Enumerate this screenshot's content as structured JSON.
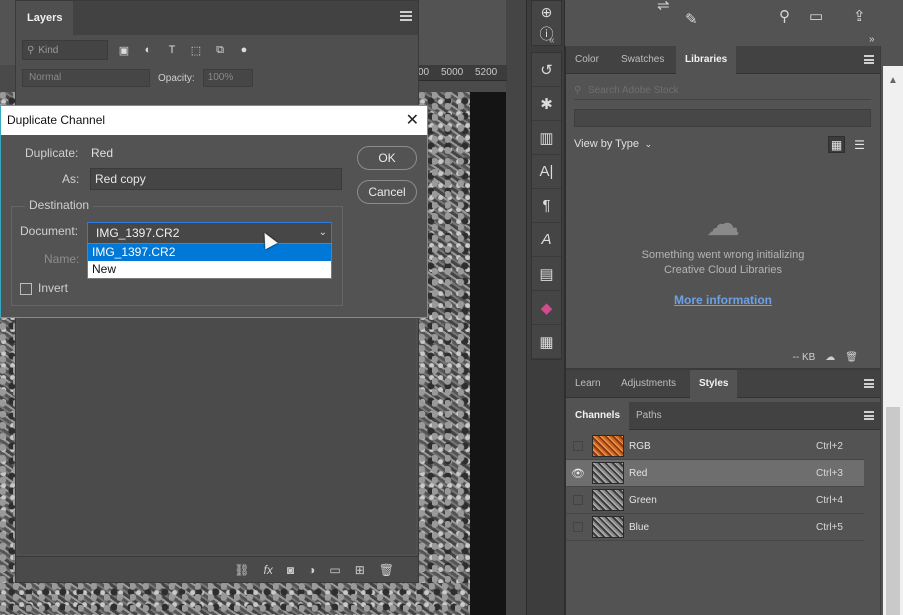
{
  "layers_panel": {
    "tab": "Layers",
    "kind_placeholder": "Kind",
    "blend_mode": "Normal",
    "opacity_label": "Opacity:",
    "opacity_value": "100%"
  },
  "ruler": {
    "ticks": [
      "00",
      "5000",
      "5200"
    ]
  },
  "dialog": {
    "title": "Duplicate Channel",
    "close": "✕",
    "duplicate_label": "Duplicate:",
    "duplicate_value": "Red",
    "as_label": "As:",
    "as_value": "Red copy",
    "ok_label": "OK",
    "cancel_label": "Cancel",
    "destination_legend": "Destination",
    "document_label": "Document:",
    "document_value": "IMG_1397.CR2",
    "document_options": [
      "IMG_1397.CR2",
      "New"
    ],
    "name_label": "Name:",
    "invert_label": "Invert"
  },
  "libraries_panel": {
    "tabs": [
      "Color",
      "Swatches",
      "Libraries"
    ],
    "active_tab": "Libraries",
    "search_placeholder": "Search Adobe Stock",
    "view_by": "View by Type",
    "error_line1": "Something went wrong initializing",
    "error_line2": "Creative Cloud Libraries",
    "more_info": "More information",
    "storage": "-- KB"
  },
  "adjust_tabs": [
    "Learn",
    "Adjustments",
    "Styles"
  ],
  "channels_panel": {
    "tabs": [
      "Channels",
      "Paths"
    ],
    "rows": [
      {
        "name": "RGB",
        "shortcut": "Ctrl+2",
        "visible": false,
        "selected": false
      },
      {
        "name": "Red",
        "shortcut": "Ctrl+3",
        "visible": true,
        "selected": true
      },
      {
        "name": "Green",
        "shortcut": "Ctrl+4",
        "visible": false,
        "selected": false
      },
      {
        "name": "Blue",
        "shortcut": "Ctrl+5",
        "visible": false,
        "selected": false
      }
    ]
  },
  "colors": {
    "dialog_border": "#38a8bf",
    "selection_blue": "#0078d7",
    "link_blue": "#6ea0e8"
  }
}
